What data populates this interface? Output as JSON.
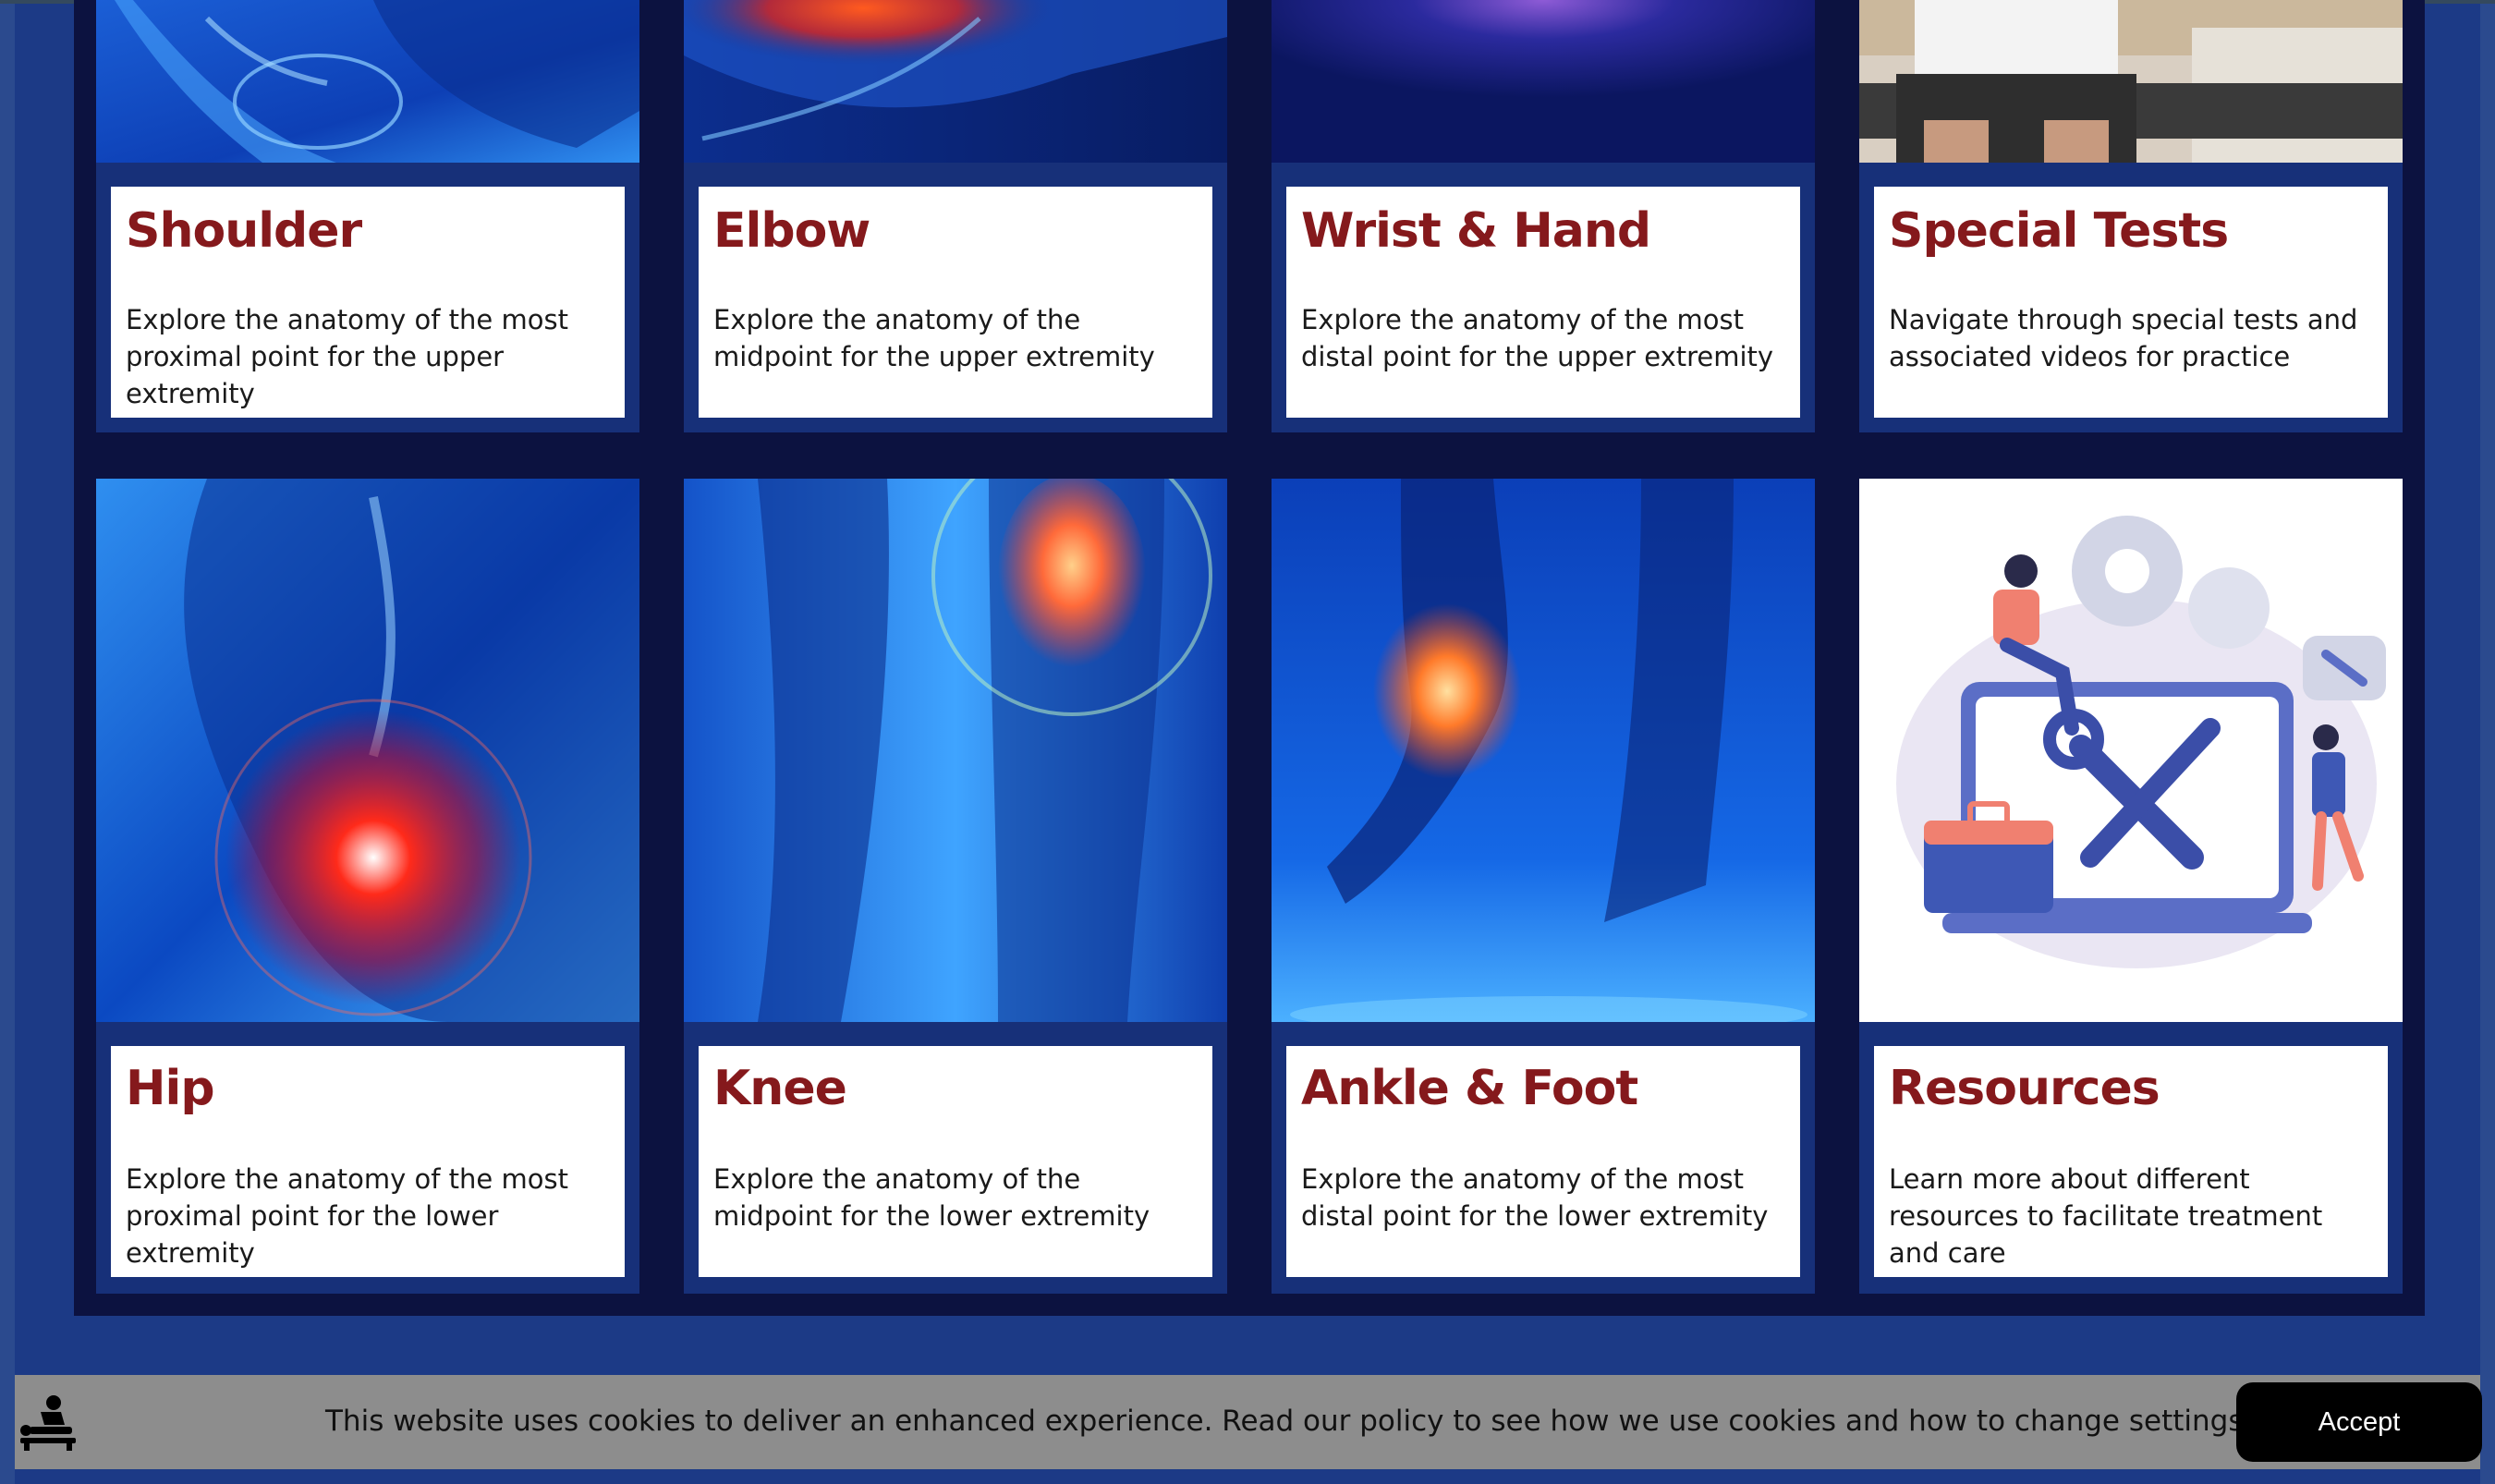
{
  "cards_top": [
    {
      "title": "Shoulder",
      "description": "Explore the anatomy of the most proximal point for the upper extremity",
      "image_icon": "shoulder-xray-image"
    },
    {
      "title": "Elbow",
      "description": "Explore the anatomy of the midpoint for the upper extremity",
      "image_icon": "elbow-xray-image"
    },
    {
      "title": "Wrist & Hand",
      "description": "Explore the anatomy of the most distal point for the upper extremity",
      "image_icon": "wrist-xray-image"
    },
    {
      "title": "Special Tests",
      "description": "Navigate through special tests and associated videos for practice",
      "image_icon": "patient-photo-image"
    }
  ],
  "cards_bottom": [
    {
      "title": "Hip",
      "description": "Explore the anatomy of the most proximal point for the lower extremity",
      "image_icon": "hip-xray-image"
    },
    {
      "title": "Knee",
      "description": "Explore the anatomy of the midpoint for the lower extremity",
      "image_icon": "knee-xray-image"
    },
    {
      "title": "Ankle & Foot",
      "description": "Explore the anatomy of the most distal point for the lower extremity",
      "image_icon": "ankle-xray-image"
    },
    {
      "title": "Resources",
      "description": "Learn more about different resources to facilitate treatment and care",
      "image_icon": "tools-illustration-image"
    }
  ],
  "cookie": {
    "message": "This website uses cookies to deliver an enhanced experience. Read our policy to see how we use cookies and how to change settings.",
    "accept_label": "Accept",
    "icon": "physical-therapy-icon"
  },
  "colors": {
    "page_bg": "#1c3a86",
    "panel_bg": "#0c1240",
    "card_frame": "#173079",
    "title": "#85191c",
    "cookie_bar": "#8d8d8d",
    "accept_bg": "#000000"
  }
}
